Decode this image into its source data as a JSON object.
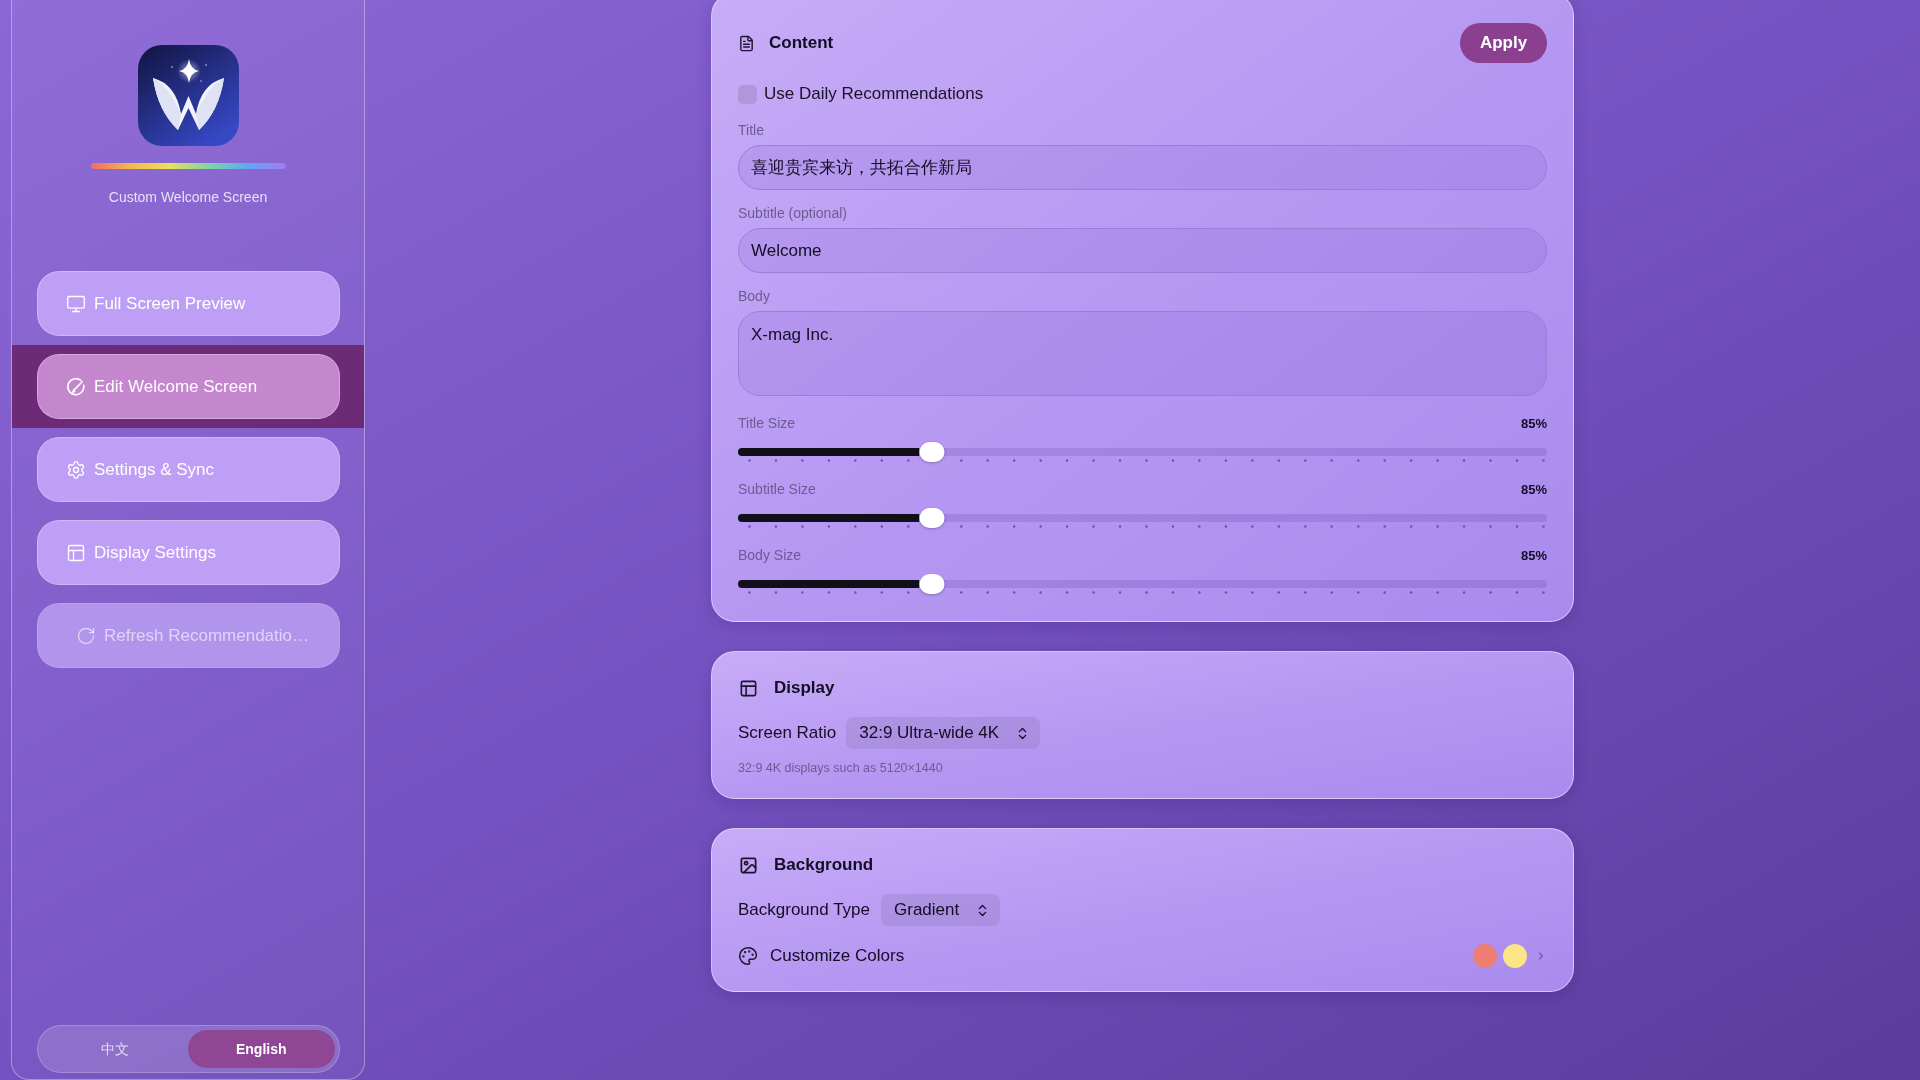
{
  "sidebar": {
    "app_caption": "Custom Welcome Screen",
    "nav_items": [
      {
        "label": "Full Screen Preview",
        "selected": false,
        "disabled": false
      },
      {
        "label": "Edit Welcome Screen",
        "selected": true,
        "disabled": false
      },
      {
        "label": "Settings & Sync",
        "selected": false,
        "disabled": false
      },
      {
        "label": "Display Settings",
        "selected": false,
        "disabled": false
      },
      {
        "label": "Refresh Recommendatio…",
        "selected": false,
        "disabled": true
      }
    ],
    "language_toggle": [
      {
        "label": "中文",
        "selected": false
      },
      {
        "label": "English",
        "selected": true
      }
    ]
  },
  "content_card": {
    "title": "Content",
    "apply_button": "Apply",
    "daily_recommendations": {
      "label": "Use Daily Recommendations",
      "checked": false
    },
    "fields": [
      {
        "kind": "input",
        "label": "Title",
        "value": "喜迎贵宾来访，共拓合作新局"
      },
      {
        "kind": "input",
        "label": "Subtitle (optional)",
        "value": "Welcome"
      },
      {
        "kind": "textarea",
        "label": "Body",
        "value": "X-mag Inc."
      }
    ],
    "sliders": [
      {
        "label": "Title Size",
        "reading": "85%",
        "level": 0.24
      },
      {
        "label": "Subtitle Size",
        "reading": "85%",
        "level": 0.24
      },
      {
        "label": "Body Size",
        "reading": "85%",
        "level": 0.24
      }
    ]
  },
  "display_card": {
    "title": "Display",
    "screen_ratio": {
      "label": "Screen Ratio",
      "value": "32:9 Ultra-wide 4K"
    },
    "hint": "32:9 4K displays such as 5120×1440"
  },
  "background_card": {
    "title": "Background",
    "background_type": {
      "label": "Background Type",
      "value": "Gradient"
    },
    "customize_colors": {
      "label": "Customize Colors",
      "swatches": [
        {
          "color": "#ee7d72"
        },
        {
          "color": "#fbe585"
        }
      ]
    }
  }
}
